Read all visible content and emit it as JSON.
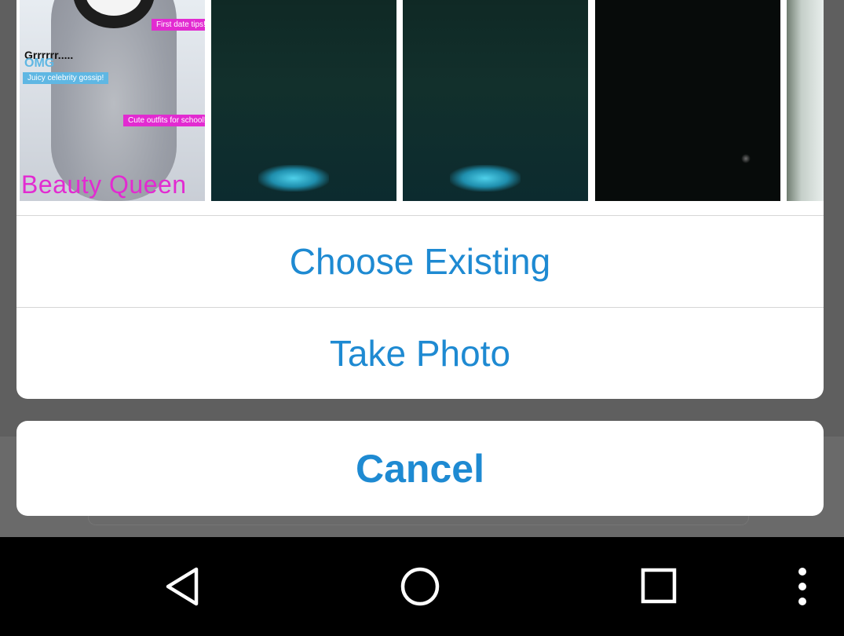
{
  "thumbnails": [
    {
      "tags": [
        "First date tips!",
        "Juicy celebrity gossip!",
        "Cute outfits for school!"
      ],
      "grr": "Grrrrrr.....",
      "omg": "OMG",
      "title": "Beauty Queen"
    },
    {},
    {},
    {},
    {}
  ],
  "actions": {
    "choose_existing": "Choose Existing",
    "take_photo": "Take Photo",
    "cancel": "Cancel"
  },
  "colors": {
    "accent": "#1e8ad2",
    "magenta": "#e22bd1"
  },
  "navbar": {
    "back": "back-icon",
    "home": "home-icon",
    "recents": "recents-icon",
    "more": "more-vert-icon"
  }
}
